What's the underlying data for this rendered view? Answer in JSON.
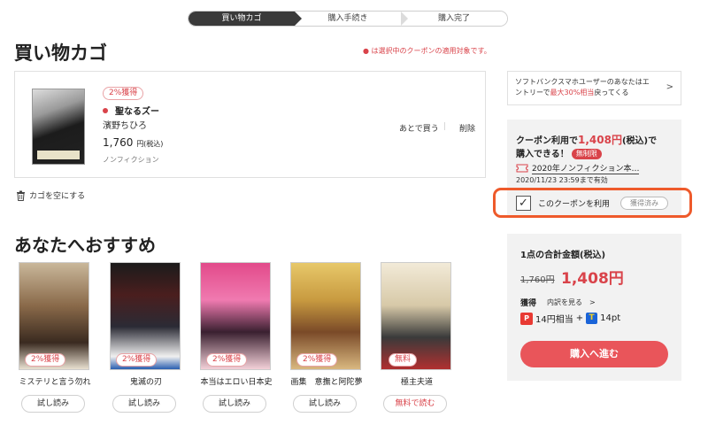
{
  "stepper": {
    "steps": [
      "買い物カゴ",
      "購入手続き",
      "購入完了"
    ]
  },
  "cart": {
    "title": "買い物カゴ",
    "coupon_note": "● は選択中のクーポンの適用対象です。",
    "item": {
      "badge": "2%獲得",
      "title": "聖なるズー",
      "author": "濱野ちひろ",
      "price": "1,760",
      "price_suffix": "円(税込)",
      "genre": "ノンフィクション",
      "later_label": "あとで買う",
      "delete_label": "削除"
    },
    "empty_label": "カゴを空にする"
  },
  "recommend": {
    "title": "あなたへおすすめ",
    "items": [
      {
        "name": "ミステリと言う勿れ",
        "badge": "2%獲得",
        "button": "試し読み"
      },
      {
        "name": "鬼滅の刃",
        "badge": "2%獲得",
        "button": "試し読み"
      },
      {
        "name": "本当はエロい日本史",
        "badge": "2%獲得",
        "button": "試し読み"
      },
      {
        "name": "画集　意撫と阿陀夢",
        "badge": "2%獲得",
        "button": "試し読み"
      },
      {
        "name": "極主夫道",
        "badge": "無料",
        "button": "無料で読む"
      }
    ]
  },
  "side": {
    "softbank": {
      "line1": "ソフトバンクスマホユーザーのあなたはエ",
      "line2_pre": "ントリーで",
      "line2_hl": "最大30%相当",
      "line2_post": "戻ってくる"
    },
    "coupon": {
      "head_pre": "クーポン利用で",
      "head_amount": "1,408円",
      "head_mid": "(税込)で",
      "head_line2": "購入できる！",
      "unlimited": "無制限",
      "name": "2020年ノンフィクション本…",
      "valid": "2020/11/23 23:59まで有効",
      "use_label": "このクーポンを利用",
      "acquired": "獲得済み",
      "checked": true
    },
    "total": {
      "label": "1点の合計金額(税込)",
      "old_price": "1,760円",
      "new_price": "1,408円",
      "get_label": "獲得",
      "breakdown": "内訳を見る　>",
      "points_a": "14円相当",
      "plus": "+",
      "points_b": "14pt",
      "buy_button": "購入へ進む"
    }
  },
  "colors": {
    "accent": "#d9434a",
    "highlight_outline": "#ee5a2b",
    "buy_button": "#e9555a",
    "panel_bg": "#f2f2f2",
    "step_active": "#3a3a3a"
  }
}
